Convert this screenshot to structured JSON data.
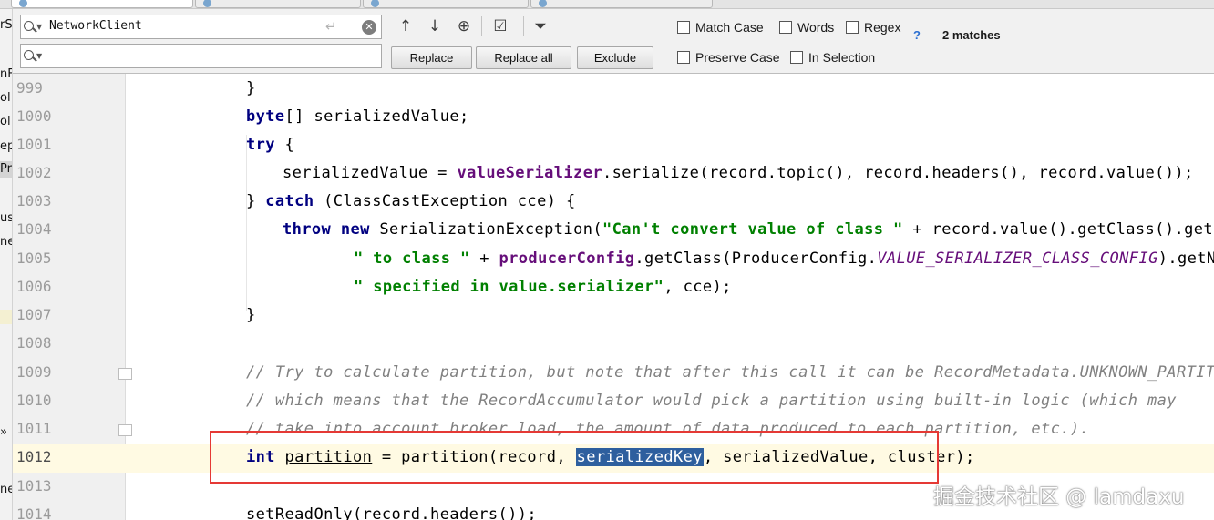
{
  "left_panel": {
    "fragments": [
      "rS",
      "nF",
      "ol",
      "ol",
      "ep",
      "Pr",
      "us",
      "ne",
      "»",
      "ne"
    ]
  },
  "find": {
    "search_value": "NetworkClient",
    "replace_value": "",
    "buttons": {
      "replace": "Replace",
      "replace_all": "Replace all",
      "exclude": "Exclude"
    },
    "options": {
      "match_case": "Match Case",
      "words": "Words",
      "regex": "Regex",
      "help": "?",
      "preserve_case": "Preserve Case",
      "in_selection": "In Selection"
    },
    "matches": "2 matches"
  },
  "editor": {
    "line_numbers": [
      "999",
      "1000",
      "1001",
      "1002",
      "1003",
      "1004",
      "1005",
      "1006",
      "1007",
      "1008",
      "1009",
      "1010",
      "1011",
      "1012",
      "1013",
      "1014"
    ],
    "current_line": "1012"
  },
  "code": {
    "l999": {
      "brace": "}"
    },
    "l1000": {
      "kw": "byte",
      "rest": "[] serializedValue;"
    },
    "l1001": {
      "kw": "try",
      "rest": " {"
    },
    "l1002": {
      "a": "serializedValue = ",
      "field": "valueSerializer",
      "b": ".serialize(record.topic(), record.headers(), record.value());"
    },
    "l1003": {
      "a": "} ",
      "kw": "catch",
      "b": " (ClassCastException cce) {"
    },
    "l1004": {
      "kw1": "throw",
      "kw2": "new",
      "a": " SerializationException(",
      "str": "\"Can't convert value of class \"",
      "b": " + record.value().getClass().getName()"
    },
    "l1005": {
      "str": "\" to class \"",
      "a": " + ",
      "field": "producerConfig",
      "b": ".getClass(ProducerConfig.",
      "static": "VALUE_SERIALIZER_CLASS_CONFIG",
      "c": ").getName()"
    },
    "l1006": {
      "str": "\" specified in value.serializer\"",
      "a": ", cce);"
    },
    "l1007": {
      "brace": "}"
    },
    "l1009": {
      "comment": "// Try to calculate partition, but note that after this call it can be RecordMetadata.UNKNOWN_PARTITION,"
    },
    "l1010": {
      "comment": "// which means that the RecordAccumulator would pick a partition using built-in logic (which may"
    },
    "l1011": {
      "comment": "// take into account broker load, the amount of data produced to each partition, etc.)."
    },
    "l1012": {
      "kw": "int",
      "var": "partition",
      "a": " = partition(record, ",
      "highlight": "serializedKey",
      "b": ", serializedValue, cluster);"
    },
    "l1014": {
      "a": "setReadOnly(record.headers());"
    }
  },
  "colors": {
    "keyword": "#000080",
    "string": "#008000",
    "comment": "#808080",
    "field": "#660e7a",
    "selection": "#2e5f9e",
    "annotation_box": "#e53935",
    "current_line": "#fffae3"
  },
  "watermark": "掘金技术社区 @ lamdaxu"
}
